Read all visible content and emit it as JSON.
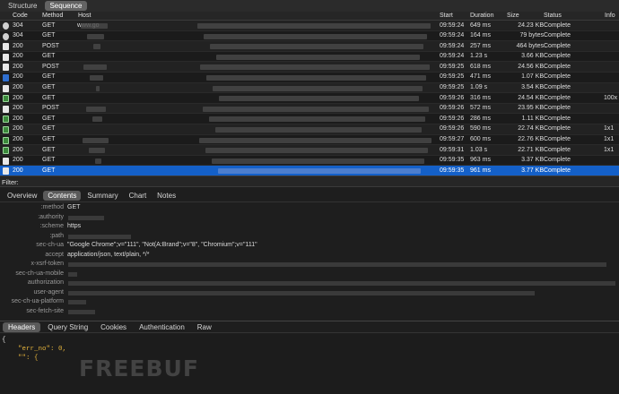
{
  "top_tabs": [
    "Structure",
    "Sequence"
  ],
  "columns": [
    "Code",
    "Method",
    "Host",
    "Start",
    "Duration",
    "Size",
    "Status",
    "Info"
  ],
  "rows": [
    {
      "icon": "circ",
      "code": "304",
      "method": "GET",
      "host": "www.go",
      "start": "09:59:24",
      "duration": "649 ms",
      "size": "24.23 KB",
      "status": "Complete",
      "info": ""
    },
    {
      "icon": "circ",
      "code": "304",
      "method": "GET",
      "host": "",
      "start": "09:59:24",
      "duration": "164 ms",
      "size": "79 bytes",
      "status": "Complete",
      "info": ""
    },
    {
      "icon": "doc",
      "code": "200",
      "method": "POST",
      "host": "",
      "start": "09:59:24",
      "duration": "257 ms",
      "size": "464 bytes",
      "status": "Complete",
      "info": ""
    },
    {
      "icon": "doc",
      "code": "200",
      "method": "GET",
      "host": "",
      "start": "09:59:24",
      "duration": "1.23 s",
      "size": "3.66 KB",
      "status": "Complete",
      "info": ""
    },
    {
      "icon": "doc",
      "code": "200",
      "method": "POST",
      "host": "",
      "start": "09:59:25",
      "duration": "618 ms",
      "size": "24.56 KB",
      "status": "Complete",
      "info": ""
    },
    {
      "icon": "blue",
      "code": "200",
      "method": "GET",
      "host": "",
      "start": "09:59:25",
      "duration": "471 ms",
      "size": "1.07 KB",
      "status": "Complete",
      "info": ""
    },
    {
      "icon": "doc",
      "code": "200",
      "method": "GET",
      "host": "",
      "start": "09:59:25",
      "duration": "1.09 s",
      "size": "3.54 KB",
      "status": "Complete",
      "info": ""
    },
    {
      "icon": "img",
      "code": "200",
      "method": "GET",
      "host": "",
      "start": "09:59:26",
      "duration": "316 ms",
      "size": "24.54 KB",
      "status": "Complete",
      "info": "100x"
    },
    {
      "icon": "doc",
      "code": "200",
      "method": "POST",
      "host": "",
      "start": "09:59:26",
      "duration": "572 ms",
      "size": "23.95 KB",
      "status": "Complete",
      "info": ""
    },
    {
      "icon": "img",
      "code": "200",
      "method": "GET",
      "host": "",
      "start": "09:59:26",
      "duration": "286 ms",
      "size": "1.11 KB",
      "status": "Complete",
      "info": ""
    },
    {
      "icon": "img",
      "code": "200",
      "method": "GET",
      "host": "",
      "start": "09:59:26",
      "duration": "590 ms",
      "size": "22.74 KB",
      "status": "Complete",
      "info": "1x1"
    },
    {
      "icon": "img",
      "code": "200",
      "method": "GET",
      "host": "",
      "start": "09:59:27",
      "duration": "600 ms",
      "size": "22.76 KB",
      "status": "Complete",
      "info": "1x1"
    },
    {
      "icon": "img",
      "code": "200",
      "method": "GET",
      "host": "",
      "start": "09:59:31",
      "duration": "1.03 s",
      "size": "22.71 KB",
      "status": "Complete",
      "info": "1x1"
    },
    {
      "icon": "doc",
      "code": "200",
      "method": "GET",
      "host": "",
      "start": "09:59:35",
      "duration": "963 ms",
      "size": "3.37 KB",
      "status": "Complete",
      "info": ""
    },
    {
      "icon": "doc",
      "code": "200",
      "method": "GET",
      "host": "",
      "start": "09:59:35",
      "duration": "961 ms",
      "size": "3.77 KB",
      "status": "Complete",
      "info": "",
      "selected": true
    }
  ],
  "filter_label": "Filter:",
  "detail_tabs": [
    "Overview",
    "Contents",
    "Summary",
    "Chart",
    "Notes"
  ],
  "request_headers": [
    {
      "k": ":method",
      "v": "GET"
    },
    {
      "k": ":authority",
      "v": ""
    },
    {
      "k": ":scheme",
      "v": "https"
    },
    {
      "k": ":path",
      "v": ""
    },
    {
      "k": "sec-ch-ua",
      "v": "\"Google Chrome\";v=\"111\", \"Not(A:Brand\";v=\"8\", \"Chromium\";v=\"111\""
    },
    {
      "k": "accept",
      "v": "application/json, text/plain, */*"
    },
    {
      "k": "x-xsrf-token",
      "v": ""
    },
    {
      "k": "sec-ch-ua-mobile",
      "v": ""
    },
    {
      "k": "authorization",
      "v": ""
    },
    {
      "k": "user-agent",
      "v": ""
    },
    {
      "k": "sec-ch-ua-platform",
      "v": ""
    },
    {
      "k": "sec-fetch-site",
      "v": ""
    }
  ],
  "body_tabs": [
    "Headers",
    "Query String",
    "Cookies",
    "Authentication",
    "Raw"
  ],
  "json_lines": [
    "{",
    "    \"err_no\": 0,",
    "    \"\": {"
  ],
  "watermark": "FREEBUF"
}
